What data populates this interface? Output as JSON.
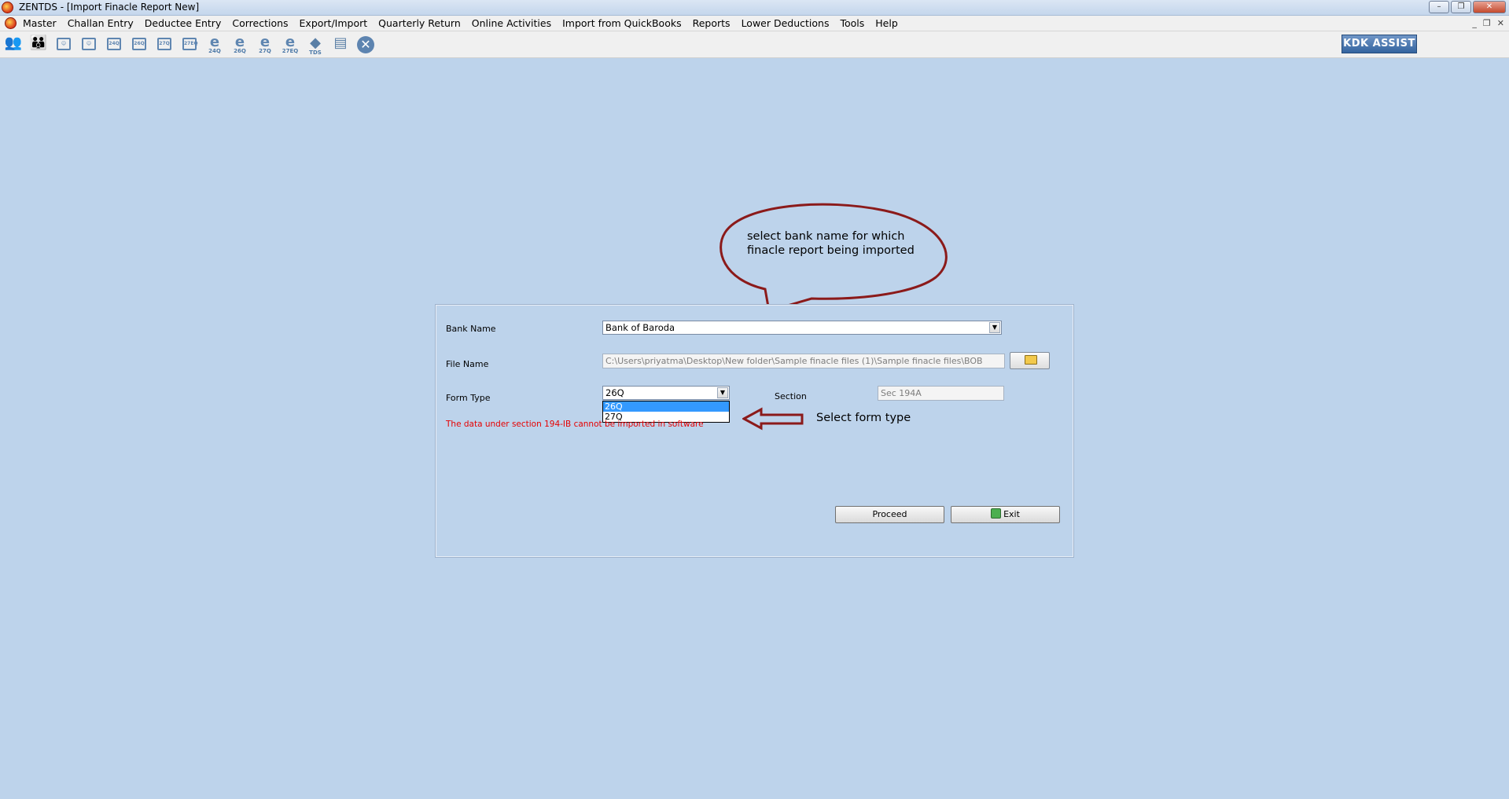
{
  "window": {
    "title": "ZENTDS - [Import Finacle Report New]",
    "controls": {
      "minimize": "–",
      "maximize": "❐",
      "close": "✕"
    }
  },
  "menubar": {
    "items": [
      "Master",
      "Challan Entry",
      "Deductee Entry",
      "Corrections",
      "Export/Import",
      "Quarterly Return",
      "Online Activities",
      "Import from QuickBooks",
      "Reports",
      "Lower Deductions",
      "Tools",
      "Help"
    ],
    "mdi_controls": {
      "minimize": "_",
      "restore": "❐",
      "close": "✕"
    }
  },
  "toolbar": {
    "icons": [
      {
        "name": "users-icon",
        "glyph": "👥",
        "sub": ""
      },
      {
        "name": "group-icon",
        "glyph": "👪",
        "sub": ""
      },
      {
        "name": "deductor-doc-icon",
        "glyph": "",
        "sub": ""
      },
      {
        "name": "deductee-doc-icon",
        "glyph": "",
        "sub": ""
      },
      {
        "name": "form-24q-icon",
        "glyph": "",
        "sub": "24Q"
      },
      {
        "name": "form-26q-icon",
        "glyph": "",
        "sub": "26Q"
      },
      {
        "name": "form-27q-icon",
        "glyph": "",
        "sub": "27Q"
      },
      {
        "name": "form-27eq-icon",
        "glyph": "",
        "sub": "27EQ"
      },
      {
        "name": "e-24q-icon",
        "glyph": "e",
        "sub": "24Q"
      },
      {
        "name": "e-26q-icon",
        "glyph": "e",
        "sub": "26Q"
      },
      {
        "name": "e-27q-icon",
        "glyph": "e",
        "sub": "27Q"
      },
      {
        "name": "e-27eq-icon",
        "glyph": "e",
        "sub": "27EQ"
      },
      {
        "name": "tds-icon",
        "glyph": "◆",
        "sub": "TDS"
      },
      {
        "name": "report-icon",
        "glyph": "▤",
        "sub": ""
      },
      {
        "name": "close-icon",
        "glyph": "✕",
        "sub": ""
      }
    ],
    "kdk_button": "KDK ASSIST"
  },
  "form": {
    "bank_label": "Bank Name",
    "bank_value": "Bank of Baroda",
    "file_label": "File Name",
    "file_value": "C:\\Users\\priyatma\\Desktop\\New folder\\Sample finacle files (1)\\Sample finacle files\\BOB",
    "form_type_label": "Form Type",
    "form_type_value": "26Q",
    "form_type_options": [
      "26Q",
      "27Q"
    ],
    "section_label": "Section",
    "section_value": "Sec 194A",
    "warning": "The data under section 194-IB cannot be imported in software",
    "proceed_label": "Proceed",
    "exit_label": "Exit"
  },
  "annotations": {
    "bubble_text": "select bank name for which finacle report being imported",
    "arrow_text": "Select form type"
  },
  "colors": {
    "background": "#bdd3eb",
    "annotation": "#8b1a1a",
    "warning": "#e60000",
    "selection": "#3399ff"
  }
}
